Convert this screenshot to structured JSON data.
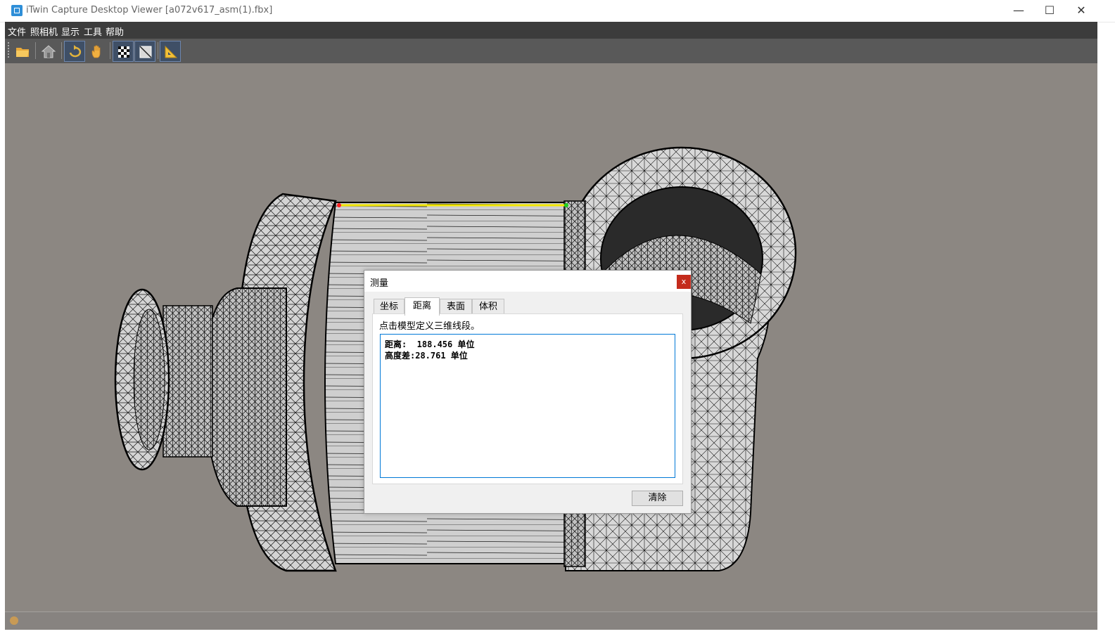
{
  "window": {
    "title": "iTwin Capture Desktop Viewer [a072v617_asm(1).fbx]",
    "controls": {
      "minimize": "—",
      "maximize": "☐",
      "close": "✕"
    }
  },
  "menu": [
    "文件",
    "照相机",
    "显示",
    "工具",
    "帮助"
  ],
  "toolbar": [
    {
      "icon": "open-folder-icon",
      "active": false
    },
    {
      "icon": "home-icon",
      "active": false
    },
    {
      "icon": "orbit-icon",
      "active": true
    },
    {
      "icon": "pan-hand-icon",
      "active": false
    },
    {
      "icon": "checker-texture-icon",
      "active": false
    },
    {
      "icon": "wireframe-icon",
      "active": false
    },
    {
      "icon": "measure-icon",
      "active": true
    }
  ],
  "dialog": {
    "title": "测量",
    "close": "x",
    "tabs": [
      "坐标",
      "距离",
      "表面",
      "体积"
    ],
    "active_tab": "距离",
    "instruction": "点击模型定义三维线段。",
    "results": {
      "distance": "距离:  188.456 单位",
      "height_diff": "高度差:28.761 单位"
    },
    "clear_button": "清除"
  },
  "colors": {
    "viewport_bg": "#8c8782",
    "menubar_bg": "#3c3c3c",
    "toolbar_bg": "#595959",
    "measure_line": "#f2e600",
    "measure_start": "#ff2020",
    "measure_end": "#20d020",
    "close_red": "#c42b1c"
  }
}
